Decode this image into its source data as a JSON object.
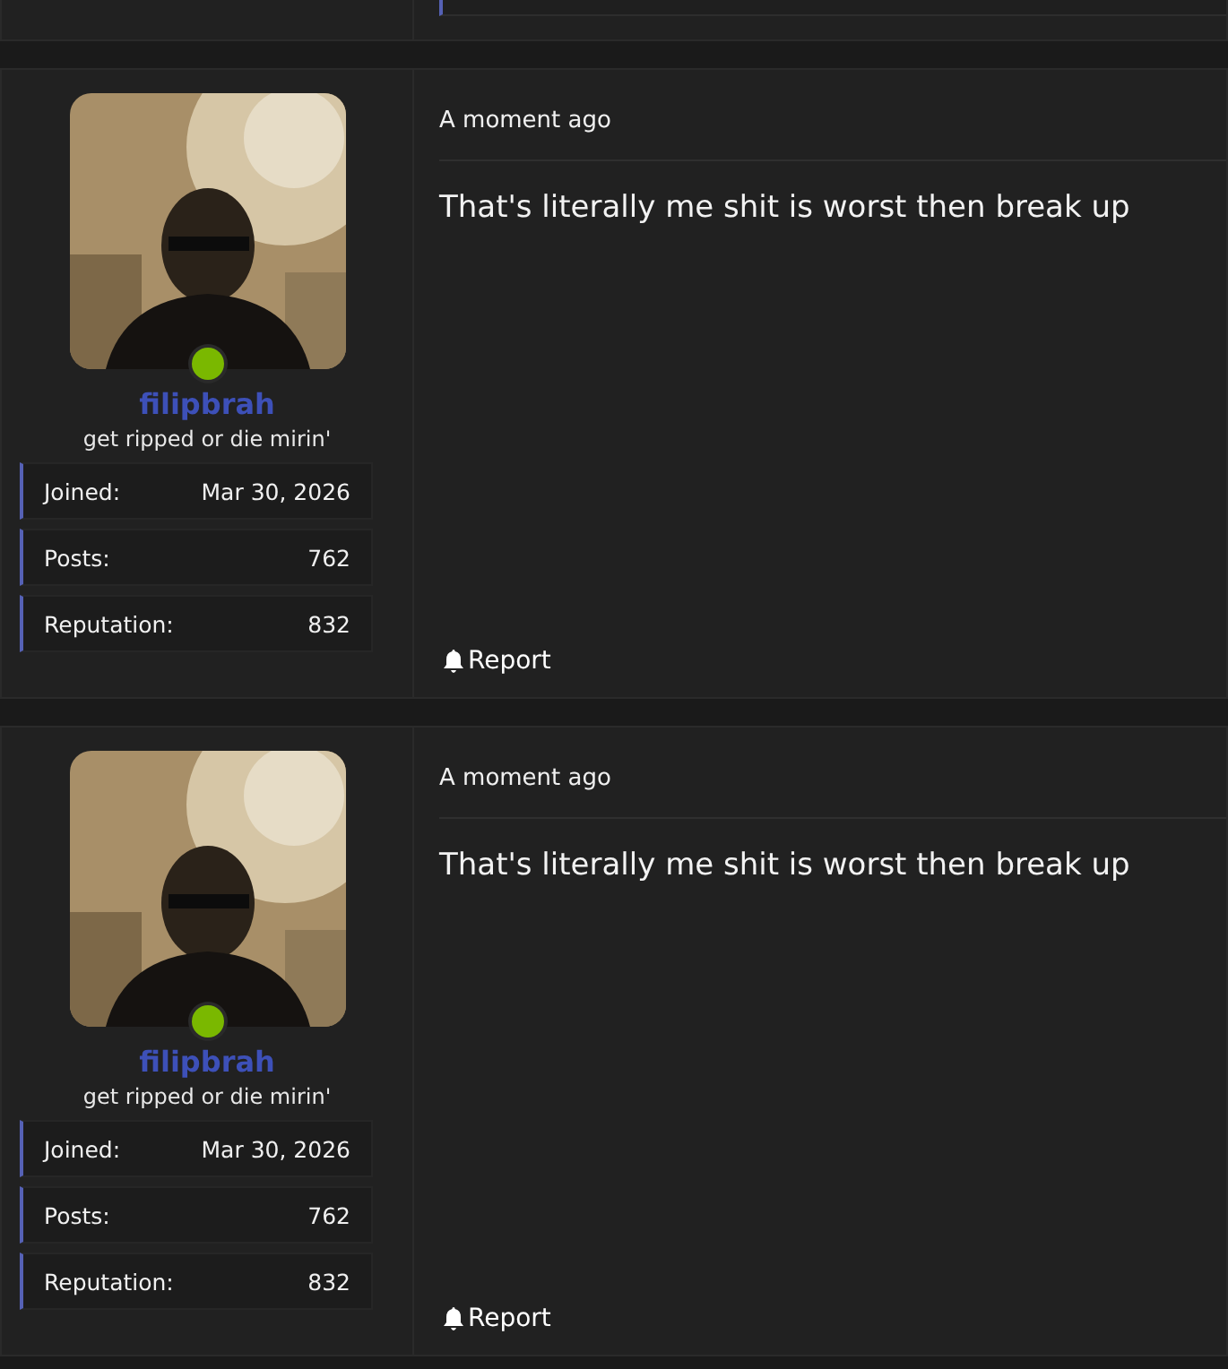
{
  "posts": [
    {
      "user": {
        "name": "filipbrah",
        "title": "get ripped or die mirin'",
        "online": true,
        "stats": [
          {
            "label": "Joined:",
            "value": "Mar 30, 2026"
          },
          {
            "label": "Posts:",
            "value": "762"
          },
          {
            "label": "Reputation:",
            "value": "832"
          }
        ]
      },
      "time": "A moment ago",
      "message": "That's literally me shit is worst then break up",
      "report": "Report"
    },
    {
      "user": {
        "name": "filipbrah",
        "title": "get ripped or die mirin'",
        "online": true,
        "stats": [
          {
            "label": "Joined:",
            "value": "Mar 30, 2026"
          },
          {
            "label": "Posts:",
            "value": "762"
          },
          {
            "label": "Reputation:",
            "value": "832"
          }
        ]
      },
      "time": "A moment ago",
      "message": "That's literally me shit is worst then break up",
      "report": "Report"
    }
  ]
}
